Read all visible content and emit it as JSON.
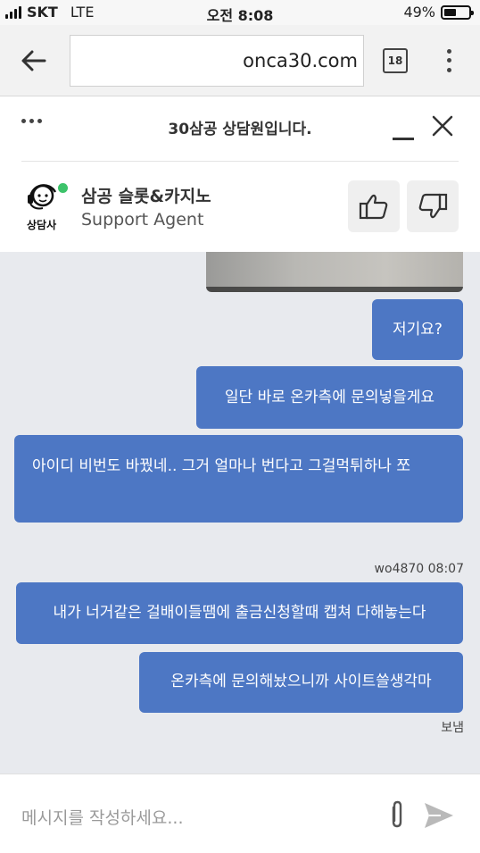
{
  "status_bar": {
    "carrier": "SKT",
    "network": "LTE",
    "time": "오전 8:08",
    "battery_percent": "49%",
    "battery_level": 0.49
  },
  "browser": {
    "url": "onca30.com",
    "tab_count": "18"
  },
  "chat_header": {
    "title": "30삼공 상담원입니다."
  },
  "agent": {
    "name": "삼공 슬롯&카지노",
    "role": "Support Agent",
    "avatar_label": "상담사",
    "online_color": "#3cc36a"
  },
  "messages": [
    {
      "id": "m1",
      "text": "저기요?"
    },
    {
      "id": "m2",
      "text": "일단 바로 온카측에 문의넣을게요"
    },
    {
      "id": "m3",
      "text": "아이디 비번도 바꿨네.. 그거 얼마나 번다고 그걸먹튀하나 쪼"
    },
    {
      "id": "m4",
      "text": "내가 너거같은 걸배이들땜에 출금신청할때 캡쳐 다해놓는다"
    },
    {
      "id": "m5",
      "text": "온카측에 문의해놨으니까 사이트쓸생각마"
    }
  ],
  "sender_meta": "wo4870 08:07",
  "sent_status": "보냄",
  "composer": {
    "placeholder": "메시지를 작성하세요..."
  },
  "colors": {
    "bubble": "#4d77c4",
    "chat_background": "#e8eaee"
  }
}
